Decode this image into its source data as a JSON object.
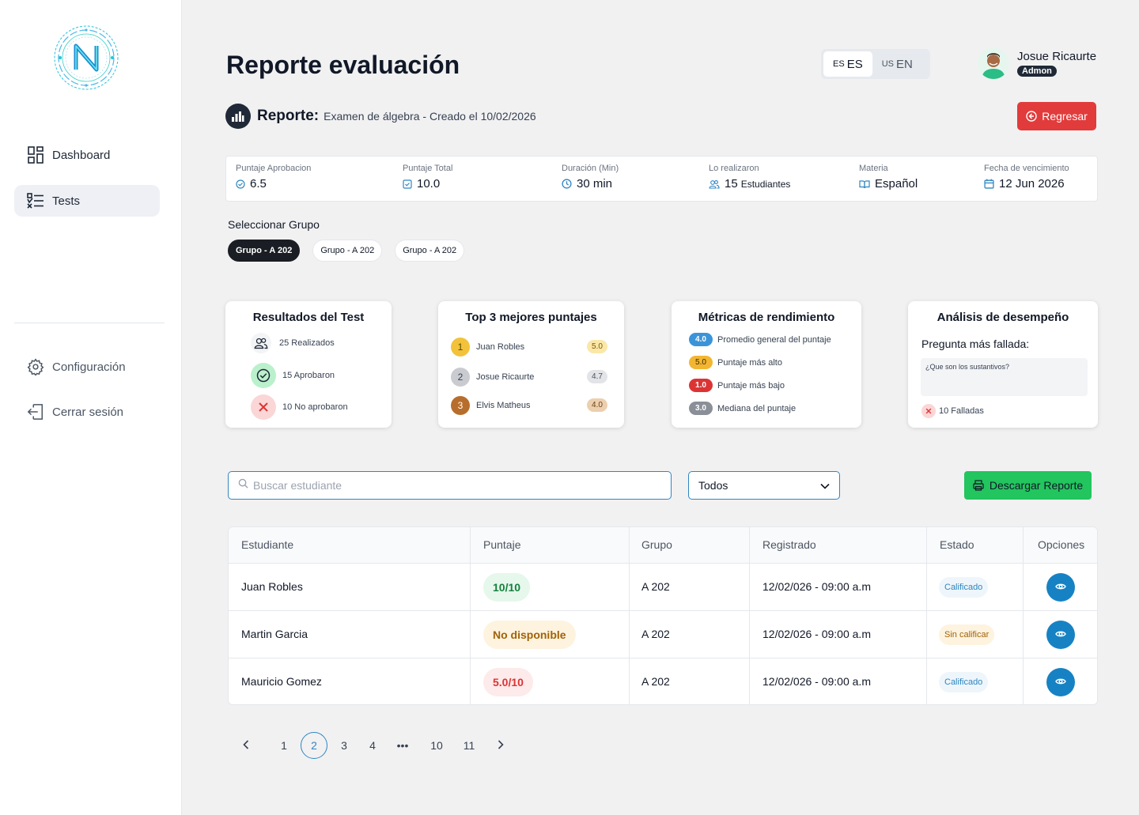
{
  "sidebar": {
    "items": [
      {
        "label": "Dashboard",
        "icon": "dashboard-icon"
      },
      {
        "label": "Tests",
        "icon": "tests-list-icon",
        "active": true
      }
    ],
    "bottom_items": [
      {
        "label": "Configuración",
        "icon": "gear-icon"
      },
      {
        "label": "Cerrar sesión",
        "icon": "logout-icon"
      }
    ]
  },
  "header": {
    "title": "Reporte evaluación",
    "languages": [
      {
        "flag": "ES",
        "label": "ES",
        "selected": true
      },
      {
        "flag": "US",
        "label": "EN",
        "selected": false
      }
    ],
    "user": {
      "name": "Josue Ricaurte",
      "role": "Admon"
    }
  },
  "report": {
    "label": "Reporte:",
    "description": "Examen de álgebra - Creado el 10/02/2026",
    "back_label": "Regresar"
  },
  "stats": [
    {
      "label": "Puntaje  Aprobacion",
      "value": "6.5",
      "icon": "check-circle-icon"
    },
    {
      "label": "Puntaje Total",
      "value": "10.0",
      "icon": "checkbox-icon"
    },
    {
      "label": "Duración (Min)",
      "value": "30 min",
      "icon": "clock-icon"
    },
    {
      "label": "Lo realizaron",
      "value": "15",
      "suffix": "Estudiantes",
      "icon": "users-icon"
    },
    {
      "label": "Materia",
      "value": "Español",
      "icon": "book-icon"
    },
    {
      "label": "Fecha de vencimiento",
      "value": "12 Jun 2026",
      "icon": "calendar-icon"
    }
  ],
  "groups": {
    "label": "Seleccionar Grupo",
    "options": [
      {
        "label": "Grupo  - A 202",
        "selected": true
      },
      {
        "label": "Grupo  - A 202",
        "selected": false
      },
      {
        "label": "Grupo  - A 202",
        "selected": false
      }
    ]
  },
  "cards": {
    "results": {
      "title": "Resultados del Test",
      "rows": [
        "25 Realizados",
        "15 Aprobaron",
        "10 No aprobaron"
      ]
    },
    "top3": {
      "title": "Top 3 mejores puntajes",
      "rows": [
        {
          "rank": "1",
          "name": "Juan Robles",
          "score": "5.0"
        },
        {
          "rank": "2",
          "name": "Josue Ricaurte",
          "score": "4.7"
        },
        {
          "rank": "3",
          "name": "Elvis Matheus",
          "score": "4.0"
        }
      ]
    },
    "metrics": {
      "title": "Métricas de rendimiento",
      "rows": [
        {
          "value": "4.0",
          "label": "Promedio general del puntaje",
          "color": "#3b94d9"
        },
        {
          "value": "5.0",
          "label": "Puntaje más alto",
          "color": "#f2b632"
        },
        {
          "value": "1.0",
          "label": "Puntaje más bajo",
          "color": "#dc3434"
        },
        {
          "value": "3.0",
          "label": "Mediana del puntaje",
          "color": "#8a8f98"
        }
      ]
    },
    "analysis": {
      "title": "Análisis de desempeño",
      "subtitle": "Pregunta más fallada:",
      "question": "¿Que son los sustantivos?",
      "failed": "10 Falladas"
    }
  },
  "toolbar": {
    "search_placeholder": "Buscar estudiante",
    "filter_value": "Todos",
    "download_label": "Descargar Reporte"
  },
  "table": {
    "headers": [
      "Estudiante",
      "Puntaje",
      "Grupo",
      "Registrado",
      "Estado",
      "Opciones"
    ],
    "rows": [
      {
        "student": "Juan Robles",
        "score": "10/10",
        "score_type": "pass",
        "group": "A 202",
        "registered": "12/02/026 - 09:00 a.m",
        "status": "Calificado",
        "status_type": "graded"
      },
      {
        "student": "Martin Garcia",
        "score": "No disponible",
        "score_type": "na",
        "group": "A 202",
        "registered": "12/02/026 - 09:00 a.m",
        "status": "Sin calificar",
        "status_type": "ungraded"
      },
      {
        "student": "Mauricio Gomez",
        "score": "5.0/10",
        "score_type": "fail",
        "group": "A 202",
        "registered": "12/02/026 - 09:00 a.m",
        "status": "Calificado",
        "status_type": "graded"
      }
    ]
  },
  "pagination": {
    "pages": [
      "1",
      "2",
      "3",
      "4",
      "•••",
      "10",
      "11"
    ],
    "current": "2"
  },
  "colors": {
    "accent": "#2f86c1",
    "danger": "#e23b3b",
    "success": "#22c55e",
    "dark": "#1a1d23"
  }
}
